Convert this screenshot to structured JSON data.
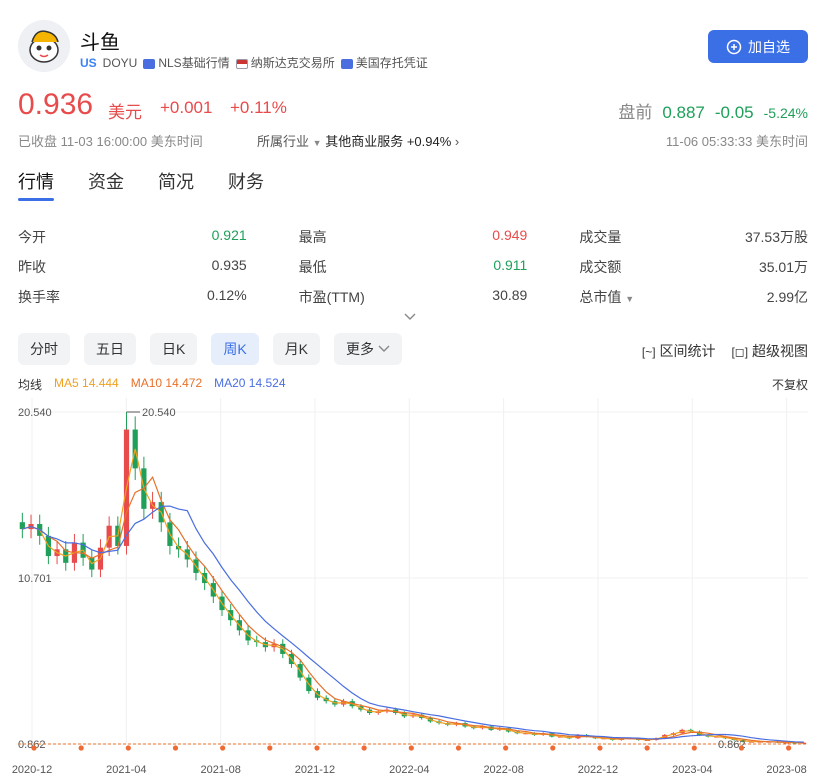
{
  "stock": {
    "name": "斗鱼",
    "market_tag": "US",
    "ticker": "DOYU",
    "tag_nls": "NLS基础行情",
    "tag_exchange": "纳斯达克交易所",
    "tag_adr": "美国存托凭证",
    "add_button": "加自选",
    "price": "0.936",
    "currency": "美元",
    "change": "+0.001",
    "change_pct": "+0.11%",
    "premarket_label": "盘前",
    "premarket_price": "0.887",
    "premarket_change": "-0.05",
    "premarket_pct": "-5.24%",
    "closed_text": "已收盘 11-03 16:00:00 美东时间",
    "industry_label": "所属行业",
    "industry_name": "其他商业服务",
    "industry_pct": "+0.94%",
    "premarket_time": "11-06 05:33:33 美东时间"
  },
  "tabs": [
    "行情",
    "资金",
    "简况",
    "财务"
  ],
  "stats": [
    [
      {
        "label": "今开",
        "value": "0.921",
        "color": "green"
      },
      {
        "label": "最高",
        "value": "0.949",
        "color": "red"
      },
      {
        "label": "成交量",
        "value": "37.53万股",
        "color": "gray"
      }
    ],
    [
      {
        "label": "昨收",
        "value": "0.935",
        "color": "gray"
      },
      {
        "label": "最低",
        "value": "0.911",
        "color": "green"
      },
      {
        "label": "成交额",
        "value": "35.01万",
        "color": "gray"
      }
    ],
    [
      {
        "label": "换手率",
        "value": "0.12%",
        "color": "gray"
      },
      {
        "label": "市盈(TTM)",
        "value": "30.89",
        "color": "gray"
      },
      {
        "label": "总市值",
        "value": "2.99亿",
        "color": "gray"
      }
    ]
  ],
  "periods": [
    "分时",
    "五日",
    "日K",
    "周K",
    "月K",
    "更多"
  ],
  "active_period": "周K",
  "tools": {
    "range_stats": "区间统计",
    "super_view": "超级视图"
  },
  "legend": {
    "title": "均线",
    "ma5": "MA5 14.444",
    "ma10": "MA10 14.472",
    "ma20": "MA20 14.524"
  },
  "restore": "不复权",
  "colors": {
    "up": "#e84b4b",
    "down": "#1ea05a",
    "ma5": "#f0a020",
    "ma10": "#e8702a",
    "ma20": "#4a6ee0",
    "accent": "#3b6fe6"
  },
  "chart_data": {
    "type": "candlestick",
    "title": "",
    "ylim": [
      0.862,
      20.54
    ],
    "y_ticks": [
      "20.540",
      "10.701",
      "0.862"
    ],
    "x_labels": [
      "2020-12",
      "2021-04",
      "2021-08",
      "2021-12",
      "2022-04",
      "2022-08",
      "2022-12",
      "2023-04",
      "2023-08"
    ],
    "max_label": "20.540",
    "min_label": "0.862",
    "close_series": [
      13.6,
      13.9,
      13.2,
      12.0,
      12.4,
      11.6,
      12.8,
      11.9,
      11.2,
      12.5,
      13.8,
      12.6,
      19.5,
      17.2,
      14.8,
      15.2,
      14.0,
      12.6,
      12.4,
      11.8,
      11.0,
      10.4,
      9.6,
      8.8,
      8.2,
      7.6,
      7.0,
      6.9,
      6.6,
      6.8,
      6.2,
      5.6,
      4.8,
      4.0,
      3.6,
      3.4,
      3.2,
      3.4,
      3.1,
      2.9,
      2.7,
      2.8,
      2.9,
      2.7,
      2.5,
      2.6,
      2.4,
      2.2,
      2.1,
      2.0,
      2.1,
      1.9,
      1.8,
      1.9,
      1.7,
      1.8,
      1.6,
      1.5,
      1.5,
      1.4,
      1.5,
      1.3,
      1.3,
      1.2,
      1.4,
      1.3,
      1.2,
      1.2,
      1.1,
      1.2,
      1.2,
      1.1,
      1.1,
      1.2,
      1.4,
      1.5,
      1.7,
      1.6,
      1.4,
      1.3,
      1.3,
      1.2,
      1.1,
      1.0,
      1.0,
      1.0,
      1.0,
      0.95,
      0.95,
      0.94,
      0.94
    ]
  }
}
